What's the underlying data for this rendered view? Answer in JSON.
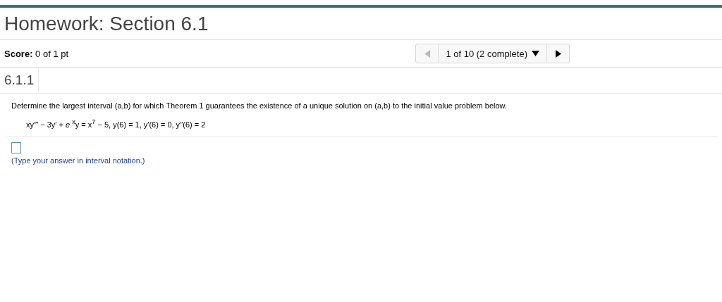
{
  "title": "Homework: Section 6.1",
  "score": "**Score:** 0 of 1 pt",
  "navigator": {
    "prev": {
      "disabled": true
    },
    "position": "1 of 10 (2 complete)",
    "next": {
      "disabled": false
    }
  },
  "question_number": "6.1.1",
  "question": "Determine the largest interval (a,b) for which Theorem 1 guarantees the existence of a unique solution on (a,b) to the initial value problem below.",
  "equation": "xy′′′ − 3y′ + *e* $^{x}$y = x$^{7}$ − 5, y(6) = 1, y′(6) = 0, y′′(6) = 2",
  "hint": "(Type your answer in interval notation.)"
}
